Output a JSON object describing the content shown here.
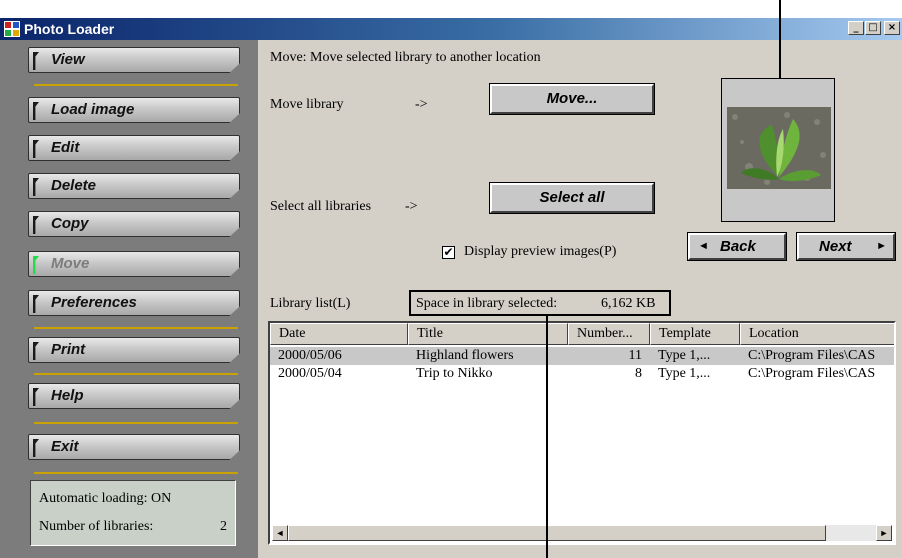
{
  "window": {
    "title": "Photo Loader"
  },
  "sidebar": {
    "items": [
      {
        "label": "View"
      },
      {
        "label": "Load image"
      },
      {
        "label": "Edit"
      },
      {
        "label": "Delete"
      },
      {
        "label": "Copy"
      },
      {
        "label": "Move"
      },
      {
        "label": "Preferences"
      },
      {
        "label": "Print"
      },
      {
        "label": "Help"
      },
      {
        "label": "Exit"
      }
    ],
    "active_item": "Move",
    "status": {
      "auto_loading_label": "Automatic loading:",
      "auto_loading_value": "ON",
      "num_libraries_label": "Number of libraries:",
      "num_libraries_value": "2"
    }
  },
  "main": {
    "description": "Move: Move selected library to another location",
    "move_library_label": "Move library",
    "move_arrow": "->",
    "move_button": "Move...",
    "select_all_label": "Select all libraries",
    "select_all_arrow": "->",
    "select_all_button": "Select all",
    "display_preview_label": "Display preview images(P)",
    "display_preview_checked": true,
    "back_button": "Back",
    "next_button": "Next",
    "library_list_label": "Library list(L)",
    "space_selected_label": "Space in library selected:",
    "space_selected_value": "6,162 KB"
  },
  "table": {
    "columns": [
      "Date",
      "Title",
      "Number...",
      "Template",
      "Location"
    ],
    "rows": [
      {
        "date": "2000/05/06",
        "title": "Highland flowers",
        "number": "11",
        "template": "Type 1,...",
        "location": "C:\\Program Files\\CAS"
      },
      {
        "date": "2000/05/04",
        "title": "Trip to Nikko",
        "number": "8",
        "template": "Type 1,...",
        "location": "C:\\Program Files\\CAS"
      }
    ],
    "selected_row": 0
  },
  "colors": {
    "titlebar_start": "#0a246a",
    "active_indicator": "#22dd44",
    "divider": "#c9a200",
    "sidebar_bg": "#7c7c7c"
  }
}
